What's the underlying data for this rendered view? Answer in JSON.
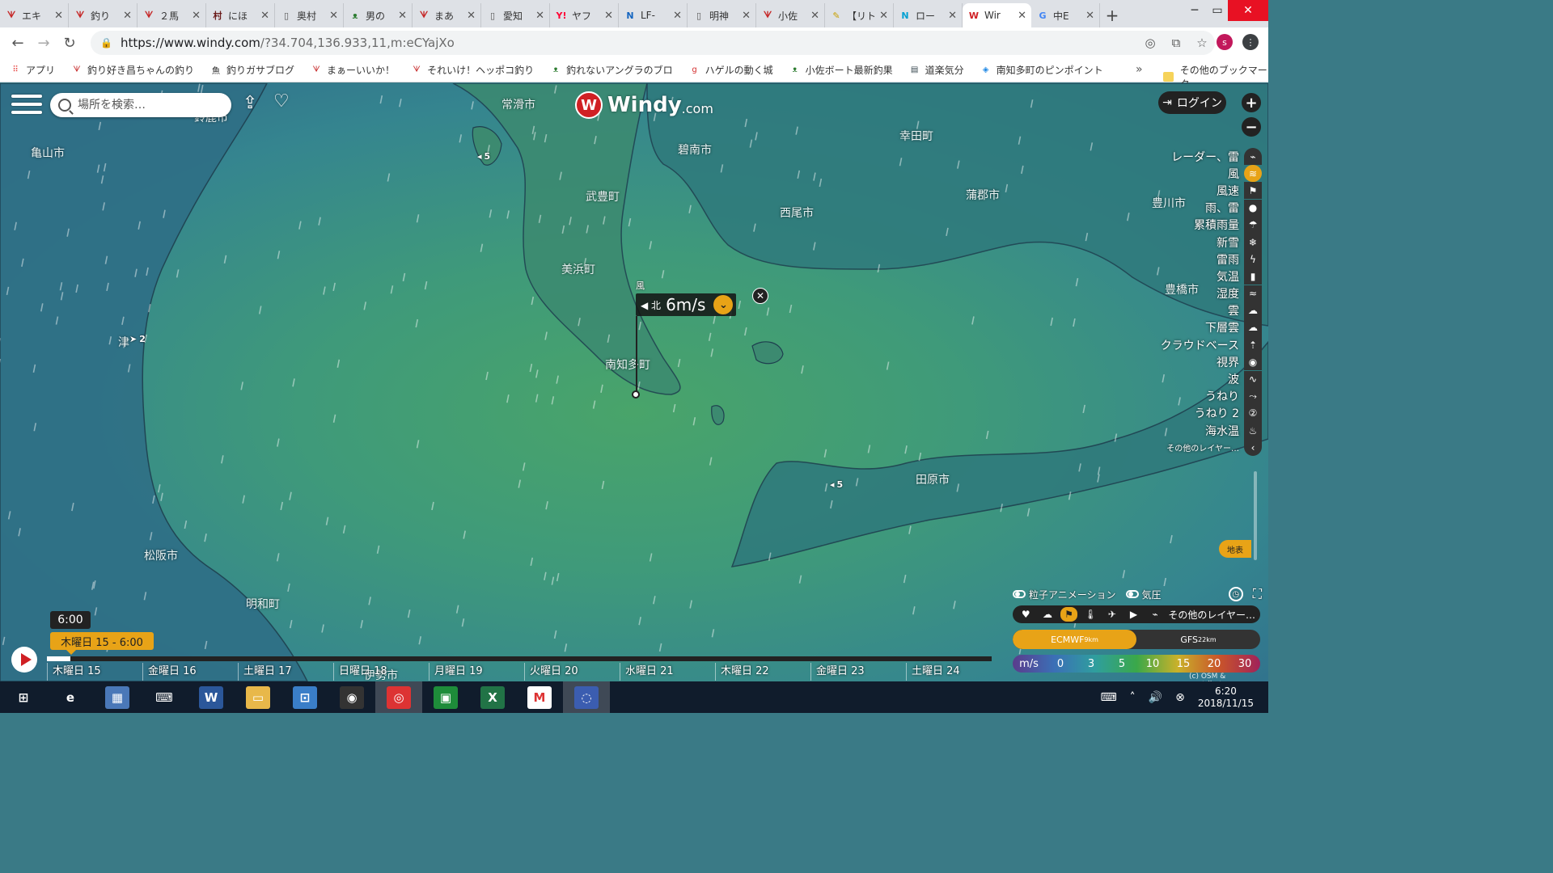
{
  "browser": {
    "tabs": [
      {
        "label": "エキ",
        "icon": "bird-icon",
        "color": "#c62828"
      },
      {
        "label": "釣り",
        "icon": "bird-icon",
        "color": "#c62828"
      },
      {
        "label": "２馬",
        "icon": "bird-icon",
        "color": "#c62828"
      },
      {
        "label": "にほ",
        "icon": "mura-icon",
        "color": "#6a1b1b"
      },
      {
        "label": "奥村",
        "icon": "page-icon",
        "color": "#555555"
      },
      {
        "label": "男の",
        "icon": "frog-icon",
        "color": "#2e7d32"
      },
      {
        "label": "まあ",
        "icon": "bird-icon",
        "color": "#c62828"
      },
      {
        "label": "愛知",
        "icon": "page-icon",
        "color": "#555555"
      },
      {
        "label": "ヤフ",
        "icon": "yahoo-icon",
        "color": "#ff0033"
      },
      {
        "label": "LF-",
        "icon": "news-icon",
        "color": "#1565c0"
      },
      {
        "label": "明神",
        "icon": "page-icon",
        "color": "#555555"
      },
      {
        "label": "小佐",
        "icon": "bird-icon",
        "color": "#c62828"
      },
      {
        "label": "【リト",
        "icon": "pencil-icon",
        "color": "#c8a000"
      },
      {
        "label": "ロー",
        "icon": "n-icon",
        "color": "#00a0d2"
      },
      {
        "label": "Wir",
        "icon": "windy-icon",
        "color": "#d02024",
        "active": true
      },
      {
        "label": "中E",
        "icon": "google-icon",
        "color": "#4285f4"
      }
    ],
    "url_host": "https://www.windy.com",
    "url_rest": "/?34.704,136.933,11,m:eCYajXo",
    "avatar_letter": "s",
    "bookmarks": [
      {
        "label": "アプリ",
        "icon": "apps-icon"
      },
      {
        "label": "釣り好き昌ちゃんの釣り",
        "icon": "bird-icon"
      },
      {
        "label": "釣りガサブログ",
        "icon": "fish-icon"
      },
      {
        "label": "まぁーいいか！",
        "icon": "bird-icon"
      },
      {
        "label": "それいけ！ヘッポコ釣り",
        "icon": "bird-icon"
      },
      {
        "label": "釣れないアングラのブロ",
        "icon": "frog-icon"
      },
      {
        "label": "ハゲルの動く城",
        "icon": "g-icon"
      },
      {
        "label": "小佐ボート最新釣果",
        "icon": "frog-icon"
      },
      {
        "label": "道楽気分",
        "icon": "photo-icon"
      },
      {
        "label": "南知多町のピンポイント",
        "icon": "cube-icon"
      }
    ],
    "bookmarks_more": "»",
    "bookmarks_other": "その他のブックマーク"
  },
  "windy": {
    "search_placeholder": "場所を検索…",
    "logo_word": "Windy",
    "logo_domain": ".com",
    "login": "ログイン",
    "zoom_in": "+",
    "zoom_out": "−",
    "layers": [
      {
        "label": "レーダー、雷",
        "icon": "radar-icon"
      },
      {
        "label": "風",
        "icon": "wind-icon",
        "selected": true
      },
      {
        "label": "風速",
        "icon": "flag-icon"
      },
      {
        "label": "雨、雷",
        "icon": "drop-icon"
      },
      {
        "label": "累積雨量",
        "icon": "cloud-rain-icon"
      },
      {
        "label": "新雪",
        "icon": "snowflake-icon"
      },
      {
        "label": "雷雨",
        "icon": "thunder-icon"
      },
      {
        "label": "気温",
        "icon": "thermometer-icon"
      },
      {
        "label": "湿度",
        "icon": "humidity-icon"
      },
      {
        "label": "雲",
        "icon": "cloud-icon"
      },
      {
        "label": "下層雲",
        "icon": "low-cloud-icon"
      },
      {
        "label": "クラウドベース",
        "icon": "cloudbase-icon"
      },
      {
        "label": "視界",
        "icon": "eye-icon"
      },
      {
        "label": "波",
        "icon": "waves-icon"
      },
      {
        "label": "うねり",
        "icon": "swell-icon"
      },
      {
        "label": "うねり 2",
        "icon": "swell2-icon"
      },
      {
        "label": "海水温",
        "icon": "sea-temp-icon"
      },
      {
        "label": "その他のレイヤー…",
        "icon": "chevron-left-icon",
        "small": true
      }
    ],
    "picker": {
      "title": "風",
      "direction": "北",
      "value": "6m/s"
    },
    "cities": [
      {
        "name": "常滑市",
        "cls": "c1"
      },
      {
        "name": "碧南市",
        "cls": "c2"
      },
      {
        "name": "幸田町",
        "cls": "c3"
      },
      {
        "name": "武豊町",
        "cls": "c4"
      },
      {
        "name": "西尾市",
        "cls": "c5"
      },
      {
        "name": "蒲郡市",
        "cls": "c6"
      },
      {
        "name": "豊川市",
        "cls": "c7"
      },
      {
        "name": "美浜町",
        "cls": "c8"
      },
      {
        "name": "豊橋市",
        "cls": "c9"
      },
      {
        "name": "南知多町",
        "cls": "c10"
      },
      {
        "name": "田原市",
        "cls": "c11"
      },
      {
        "name": "亀山市",
        "cls": "c12"
      },
      {
        "name": "鈴鹿市",
        "cls": "c13"
      },
      {
        "name": "津",
        "cls": "c14"
      },
      {
        "name": "松阪市",
        "cls": "c15"
      },
      {
        "name": "明和町",
        "cls": "c16"
      },
      {
        "name": "伊勢市",
        "cls": "c17"
      }
    ],
    "wind_badges": [
      {
        "value": "5",
        "cls": "w1"
      },
      {
        "value": "2",
        "cls": "w2"
      },
      {
        "value": "5",
        "cls": "w3"
      }
    ],
    "timeline": {
      "time": "6:00",
      "date": "木曜日 15 - 6:00",
      "days": [
        "木曜日 15",
        "金曜日 16",
        "土曜日 17",
        "日曜日 18",
        "月曜日 19",
        "火曜日 20",
        "水曜日 21",
        "木曜日 22",
        "金曜日 23",
        "土曜日 24"
      ],
      "progress": 0.025
    },
    "options": {
      "particles": "粒子アニメーション",
      "pressure": "気圧"
    },
    "quick_more": "その他のレイヤー…",
    "models": [
      {
        "name": "ECMWF",
        "res": "9km",
        "selected": true
      },
      {
        "name": "GFS",
        "res": "22km",
        "selected": false
      }
    ],
    "legend": {
      "unit": "m/s",
      "values": [
        "0",
        "3",
        "5",
        "10",
        "15",
        "20",
        "30"
      ],
      "colors": [
        "#5a3c8c",
        "#3b6fb6",
        "#2f9e9e",
        "#3aa84a",
        "#c9b12a",
        "#c9552a",
        "#a0225a"
      ]
    },
    "credit": "(c) OSM & contributors",
    "chiku_label": "地表"
  },
  "taskbar": {
    "apps": [
      {
        "name": "start-button",
        "glyph": "⊞",
        "bg": "transparent"
      },
      {
        "name": "ie-icon",
        "glyph": "e",
        "bg": "transparent"
      },
      {
        "name": "app-blue-icon",
        "glyph": "▦",
        "bg": "#4a78b8"
      },
      {
        "name": "scanner-icon",
        "glyph": "⌨",
        "bg": "transparent"
      },
      {
        "name": "word-icon",
        "glyph": "W",
        "bg": "#2b579a"
      },
      {
        "name": "explorer-icon",
        "glyph": "▭",
        "bg": "#e8b84a"
      },
      {
        "name": "network-icon",
        "glyph": "⊡",
        "bg": "#3a7ec8"
      },
      {
        "name": "media-icon",
        "glyph": "◉",
        "bg": "#333333"
      },
      {
        "name": "chrome-icon",
        "glyph": "◎",
        "bg": "#d33",
        "active": true
      },
      {
        "name": "green-app-icon",
        "glyph": "▣",
        "bg": "#1e8c3a"
      },
      {
        "name": "excel-icon",
        "glyph": "X",
        "bg": "#217346"
      },
      {
        "name": "gmail-icon",
        "glyph": "M",
        "bg": "#ffffff"
      },
      {
        "name": "app-circle-icon",
        "glyph": "◌",
        "bg": "#3b5db0",
        "active": true
      }
    ],
    "time": "6:20",
    "date": "2018/11/15"
  }
}
